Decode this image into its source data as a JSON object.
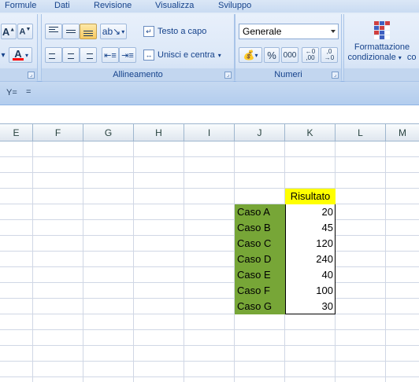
{
  "ribbon_tabs": [
    "Formule",
    "Dati",
    "Revisione",
    "Visualizza",
    "Sviluppo"
  ],
  "ribbon": {
    "font_group": {
      "grow_font_glyph": "A",
      "shrink_font_glyph": "A",
      "font_color_glyph": "A",
      "font_color": "#ff0000"
    },
    "alignment_group": {
      "label": "Allineamento",
      "wrap_text_label": "Testo a capo",
      "merge_center_label": "Unisci e centra"
    },
    "number_group": {
      "label": "Numeri",
      "format_value": "Generale",
      "percent_label": "%",
      "thousands_label": "000",
      "increase_decimal_label": ",00",
      "decrease_decimal_label": ",0"
    },
    "styles_group": {
      "conditional_format_line1": "Formattazione",
      "conditional_format_line2": "condizionale",
      "cut_label": "co"
    }
  },
  "qat": {
    "customize_glyph": "Y=",
    "more_glyph": "="
  },
  "columns": [
    "E",
    "F",
    "G",
    "H",
    "I",
    "J",
    "K",
    "L",
    "M"
  ],
  "table": {
    "header": "Risultato",
    "rows": [
      {
        "label": "Caso A",
        "value": "20"
      },
      {
        "label": "Caso B",
        "value": "45"
      },
      {
        "label": "Caso C",
        "value": "120"
      },
      {
        "label": "Caso D",
        "value": "240"
      },
      {
        "label": "Caso E",
        "value": "40"
      },
      {
        "label": "Caso F",
        "value": "100"
      },
      {
        "label": "Caso G",
        "value": "30"
      }
    ]
  },
  "colors": {
    "label_fill": "#77a637",
    "header_fill": "#ffff00",
    "gridline": "#d0d7e5"
  }
}
